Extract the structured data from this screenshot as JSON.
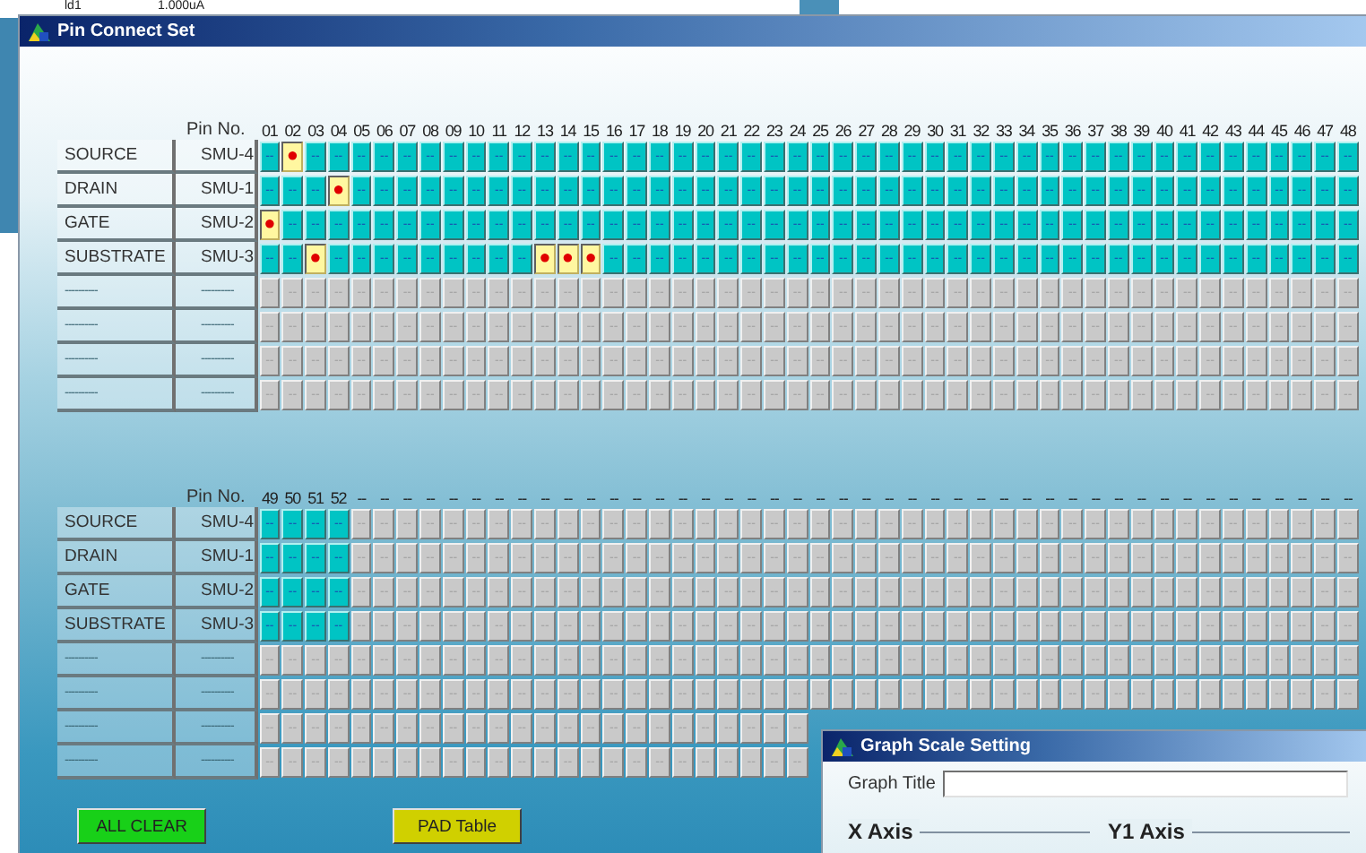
{
  "background_window": {
    "cells": [
      "ld1",
      "1.000uA"
    ]
  },
  "window": {
    "title": "Pin Connect Set"
  },
  "grids": [
    {
      "header_label": "Pin No.",
      "pins": [
        "01",
        "02",
        "03",
        "04",
        "05",
        "06",
        "07",
        "08",
        "09",
        "10",
        "11",
        "12",
        "13",
        "14",
        "15",
        "16",
        "17",
        "18",
        "19",
        "20",
        "21",
        "22",
        "23",
        "24",
        "25",
        "26",
        "27",
        "28",
        "29",
        "30",
        "31",
        "32",
        "33",
        "34",
        "35",
        "36",
        "37",
        "38",
        "39",
        "40",
        "41",
        "42",
        "43",
        "44",
        "45",
        "46",
        "47",
        "48"
      ],
      "rows": [
        {
          "terminal": "SOURCE",
          "unit": "SMU-4",
          "enabled": true,
          "cells": [
            "--",
            {
              "text": "●",
              "connected": true
            },
            "--",
            "--",
            "--",
            "--",
            "--",
            "--",
            "--",
            "--",
            "--",
            "--",
            "--",
            "--",
            "--",
            "--",
            "--",
            "--",
            "--",
            "--",
            "--",
            "--",
            "--",
            "--",
            "--",
            "--",
            "--",
            "--",
            "--",
            "--",
            "--",
            "--",
            "--",
            "--",
            "--",
            "--",
            "--",
            "--",
            "--",
            "--",
            "--",
            "--",
            "--",
            "--",
            "--",
            "--",
            "--",
            "--"
          ]
        },
        {
          "terminal": "DRAIN",
          "unit": "SMU-1",
          "enabled": true,
          "cells": [
            "--",
            "--",
            "--",
            {
              "text": "●",
              "connected": true
            },
            "--",
            "--",
            "--",
            "--",
            "--",
            "--",
            "--",
            "--",
            "--",
            "--",
            "--",
            "--",
            "--",
            "--",
            "--",
            "--",
            "--",
            "--",
            "--",
            "--",
            "--",
            "--",
            "--",
            "--",
            "--",
            "--",
            "--",
            "--",
            "--",
            "--",
            "--",
            "--",
            "--",
            "--",
            "--",
            "--",
            "--",
            "--",
            "--",
            "--",
            "--",
            "--",
            "--",
            "--"
          ]
        },
        {
          "terminal": "GATE",
          "unit": "SMU-2",
          "enabled": true,
          "cells": [
            {
              "text": "●",
              "connected": true
            },
            "--",
            "--",
            "--",
            "--",
            "--",
            "--",
            "--",
            "--",
            "--",
            "--",
            "--",
            "--",
            "--",
            "--",
            "--",
            "--",
            "--",
            "--",
            "--",
            "--",
            "--",
            "--",
            "--",
            "--",
            "--",
            "--",
            "--",
            "--",
            "--",
            "--",
            "--",
            "--",
            "--",
            "--",
            "--",
            "--",
            "--",
            "--",
            "--",
            "--",
            "--",
            "--",
            "--",
            "--",
            "--",
            "--",
            "--"
          ]
        },
        {
          "terminal": "SUBSTRATE",
          "unit": "SMU-3",
          "enabled": true,
          "cells": [
            "--",
            "--",
            {
              "text": "●",
              "connected": true
            },
            "--",
            "--",
            "--",
            "--",
            "--",
            "--",
            "--",
            "--",
            "--",
            {
              "text": "●",
              "connected": true
            },
            {
              "text": "●",
              "connected": true
            },
            {
              "text": "●",
              "connected": true
            },
            "--",
            "--",
            "--",
            "--",
            "--",
            "--",
            "--",
            "--",
            "--",
            "--",
            "--",
            "--",
            "--",
            "--",
            "--",
            "--",
            "--",
            "--",
            "--",
            "--",
            "--",
            "--",
            "--",
            "--",
            "--",
            "--",
            "--",
            "--",
            "--",
            "--",
            "--",
            "--",
            "--"
          ]
        },
        {
          "terminal": "----------",
          "unit": "----------",
          "enabled": false,
          "cells": [
            "--",
            "--",
            "--",
            "--",
            "--",
            "--",
            "--",
            "--",
            "--",
            "--",
            "--",
            "--",
            "--",
            "--",
            "--",
            "--",
            "--",
            "--",
            "--",
            "--",
            "--",
            "--",
            "--",
            "--",
            "--",
            "--",
            "--",
            "--",
            "--",
            "--",
            "--",
            "--",
            "--",
            "--",
            "--",
            "--",
            "--",
            "--",
            "--",
            "--",
            "--",
            "--",
            "--",
            "--",
            "--",
            "--",
            "--",
            "--"
          ]
        },
        {
          "terminal": "----------",
          "unit": "----------",
          "enabled": false,
          "cells": [
            "--",
            "--",
            "--",
            "--",
            "--",
            "--",
            "--",
            "--",
            "--",
            "--",
            "--",
            "--",
            "--",
            "--",
            "--",
            "--",
            "--",
            "--",
            "--",
            "--",
            "--",
            "--",
            "--",
            "--",
            "--",
            "--",
            "--",
            "--",
            "--",
            "--",
            "--",
            "--",
            "--",
            "--",
            "--",
            "--",
            "--",
            "--",
            "--",
            "--",
            "--",
            "--",
            "--",
            "--",
            "--",
            "--",
            "--",
            "--"
          ]
        },
        {
          "terminal": "----------",
          "unit": "----------",
          "enabled": false,
          "cells": [
            "--",
            "--",
            "--",
            "--",
            "--",
            "--",
            "--",
            "--",
            "--",
            "--",
            "--",
            "--",
            "--",
            "--",
            "--",
            "--",
            "--",
            "--",
            "--",
            "--",
            "--",
            "--",
            "--",
            "--",
            "--",
            "--",
            "--",
            "--",
            "--",
            "--",
            "--",
            "--",
            "--",
            "--",
            "--",
            "--",
            "--",
            "--",
            "--",
            "--",
            "--",
            "--",
            "--",
            "--",
            "--",
            "--",
            "--",
            "--"
          ]
        },
        {
          "terminal": "----------",
          "unit": "----------",
          "enabled": false,
          "cells": [
            "--",
            "--",
            "--",
            "--",
            "--",
            "--",
            "--",
            "--",
            "--",
            "--",
            "--",
            "--",
            "--",
            "--",
            "--",
            "--",
            "--",
            "--",
            "--",
            "--",
            "--",
            "--",
            "--",
            "--",
            "--",
            "--",
            "--",
            "--",
            "--",
            "--",
            "--",
            "--",
            "--",
            "--",
            "--",
            "--",
            "--",
            "--",
            "--",
            "--",
            "--",
            "--",
            "--",
            "--",
            "--",
            "--",
            "--",
            "--"
          ]
        }
      ]
    },
    {
      "header_label": "Pin No.",
      "pins": [
        "49",
        "50",
        "51",
        "52"
      ],
      "unassigned": [
        "--",
        "--",
        "--",
        "--",
        "--",
        "--",
        "--",
        "--",
        "--",
        "--",
        "--",
        "--",
        "--",
        "--",
        "--",
        "--",
        "--",
        "--",
        "--",
        "--",
        "--",
        "--",
        "--",
        "--",
        "--",
        "--",
        "--",
        "--",
        "--",
        "--",
        "--",
        "--",
        "--",
        "--",
        "--",
        "--",
        "--",
        "--",
        "--",
        "--",
        "--",
        "--",
        "--",
        "--"
      ],
      "rows": [
        {
          "terminal": "SOURCE",
          "unit": "SMU-4",
          "enabled": true,
          "cells": [
            "--",
            "--",
            "--",
            "--",
            "--",
            "--",
            "--",
            "--",
            "--",
            "--",
            "--",
            "--",
            "--",
            "--",
            "--",
            "--",
            "--",
            "--",
            "--",
            "--",
            "--",
            "--",
            "--",
            "--",
            "--",
            "--",
            "--",
            "--",
            "--",
            "--",
            "--",
            "--",
            "--",
            "--",
            "--",
            "--",
            "--",
            "--",
            "--",
            "--",
            "--",
            "--",
            "--",
            "--",
            "--",
            "--",
            "--",
            "--"
          ]
        },
        {
          "terminal": "DRAIN",
          "unit": "SMU-1",
          "enabled": true,
          "cells": [
            "--",
            "--",
            "--",
            "--",
            "--",
            "--",
            "--",
            "--",
            "--",
            "--",
            "--",
            "--",
            "--",
            "--",
            "--",
            "--",
            "--",
            "--",
            "--",
            "--",
            "--",
            "--",
            "--",
            "--",
            "--",
            "--",
            "--",
            "--",
            "--",
            "--",
            "--",
            "--",
            "--",
            "--",
            "--",
            "--",
            "--",
            "--",
            "--",
            "--",
            "--",
            "--",
            "--",
            "--",
            "--",
            "--",
            "--",
            "--"
          ]
        },
        {
          "terminal": "GATE",
          "unit": "SMU-2",
          "enabled": true,
          "cells": [
            "--",
            "--",
            "--",
            "--",
            "--",
            "--",
            "--",
            "--",
            "--",
            "--",
            "--",
            "--",
            "--",
            "--",
            "--",
            "--",
            "--",
            "--",
            "--",
            "--",
            "--",
            "--",
            "--",
            "--",
            "--",
            "--",
            "--",
            "--",
            "--",
            "--",
            "--",
            "--",
            "--",
            "--",
            "--",
            "--",
            "--",
            "--",
            "--",
            "--",
            "--",
            "--",
            "--",
            "--",
            "--",
            "--",
            "--",
            "--"
          ]
        },
        {
          "terminal": "SUBSTRATE",
          "unit": "SMU-3",
          "enabled": true,
          "cells": [
            "--",
            "--",
            "--",
            "--",
            "--",
            "--",
            "--",
            "--",
            "--",
            "--",
            "--",
            "--",
            "--",
            "--",
            "--",
            "--",
            "--",
            "--",
            "--",
            "--",
            "--",
            "--",
            "--",
            "--",
            "--",
            "--",
            "--",
            "--",
            "--",
            "--",
            "--",
            "--",
            "--",
            "--",
            "--",
            "--",
            "--",
            "--",
            "--",
            "--",
            "--",
            "--",
            "--",
            "--",
            "--",
            "--",
            "--",
            "--"
          ]
        },
        {
          "terminal": "----------",
          "unit": "----------",
          "enabled": false,
          "cells": [
            "--",
            "--",
            "--",
            "--",
            "--",
            "--",
            "--",
            "--",
            "--",
            "--",
            "--",
            "--",
            "--",
            "--",
            "--",
            "--",
            "--",
            "--",
            "--",
            "--",
            "--",
            "--",
            "--",
            "--",
            "--",
            "--",
            "--",
            "--",
            "--",
            "--",
            "--",
            "--",
            "--",
            "--",
            "--",
            "--",
            "--",
            "--",
            "--",
            "--",
            "--",
            "--",
            "--",
            "--",
            "--",
            "--",
            "--",
            "--"
          ]
        },
        {
          "terminal": "----------",
          "unit": "----------",
          "enabled": false,
          "cells": [
            "--",
            "--",
            "--",
            "--",
            "--",
            "--",
            "--",
            "--",
            "--",
            "--",
            "--",
            "--",
            "--",
            "--",
            "--",
            "--",
            "--",
            "--",
            "--",
            "--",
            "--",
            "--",
            "--",
            "--",
            "--",
            "--",
            "--",
            "--",
            "--",
            "--",
            "--",
            "--",
            "--",
            "--",
            "--",
            "--",
            "--",
            "--",
            "--",
            "--",
            "--",
            "--",
            "--",
            "--",
            "--",
            "--",
            "--",
            "--"
          ]
        },
        {
          "terminal": "----------",
          "unit": "----------",
          "enabled": false,
          "cells": [
            "--",
            "--",
            "--",
            "--",
            "--",
            "--",
            "--",
            "--",
            "--",
            "--",
            "--",
            "--",
            "--",
            "--",
            "--",
            "--",
            "--",
            "--",
            "--",
            "--",
            "--",
            "--",
            "--",
            "--"
          ]
        },
        {
          "terminal": "----------",
          "unit": "----------",
          "enabled": false,
          "cells": [
            "--",
            "--",
            "--",
            "--",
            "--",
            "--",
            "--",
            "--",
            "--",
            "--",
            "--",
            "--",
            "--",
            "--",
            "--",
            "--",
            "--",
            "--",
            "--",
            "--",
            "--",
            "--",
            "--",
            "--"
          ]
        }
      ]
    }
  ],
  "buttons": [
    {
      "label": "ALL CLEAR",
      "kind": "clear"
    },
    {
      "label": "PAD Table",
      "kind": "pad"
    }
  ],
  "dialog": {
    "title": "Graph Scale Setting",
    "field_label": "Graph Title",
    "groups": [
      "X Axis",
      "Y1 Axis"
    ]
  }
}
